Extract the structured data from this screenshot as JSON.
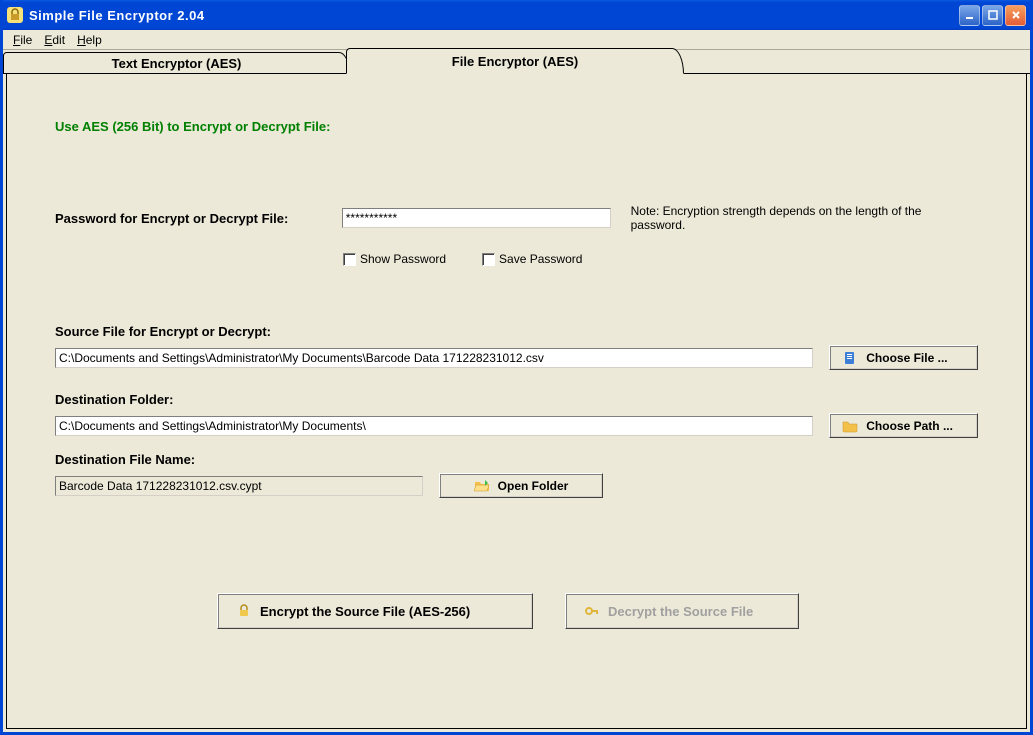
{
  "window": {
    "title": "Simple File Encryptor 2.04"
  },
  "menubar": {
    "file": "File",
    "edit": "Edit",
    "help": "Help"
  },
  "tabs": {
    "text_encryptor": "Text  Encryptor (AES)",
    "file_encryptor": "File  Encryptor (AES)"
  },
  "main": {
    "heading": "Use AES (256 Bit) to Encrypt or Decrypt File:",
    "password_label": "Password for Encrypt or Decrypt File:",
    "password_value": "***********",
    "password_note": "Note: Encryption strength depends on the length of the password.",
    "show_password_label": "Show Password",
    "save_password_label": "Save Password",
    "source_label": "Source File for Encrypt or Decrypt:",
    "source_value": "C:\\Documents and Settings\\Administrator\\My Documents\\Barcode Data 171228231012.csv",
    "choose_file_label": "Choose File ...",
    "dest_folder_label": "Destination Folder:",
    "dest_folder_value": "C:\\Documents and Settings\\Administrator\\My Documents\\",
    "choose_path_label": "Choose Path ...",
    "dest_file_label": "Destination File Name:",
    "dest_file_value": "Barcode Data 171228231012.csv.cypt",
    "open_folder_label": "Open Folder",
    "encrypt_button": "Encrypt the Source File (AES-256)",
    "decrypt_button": "Decrypt the Source File"
  }
}
